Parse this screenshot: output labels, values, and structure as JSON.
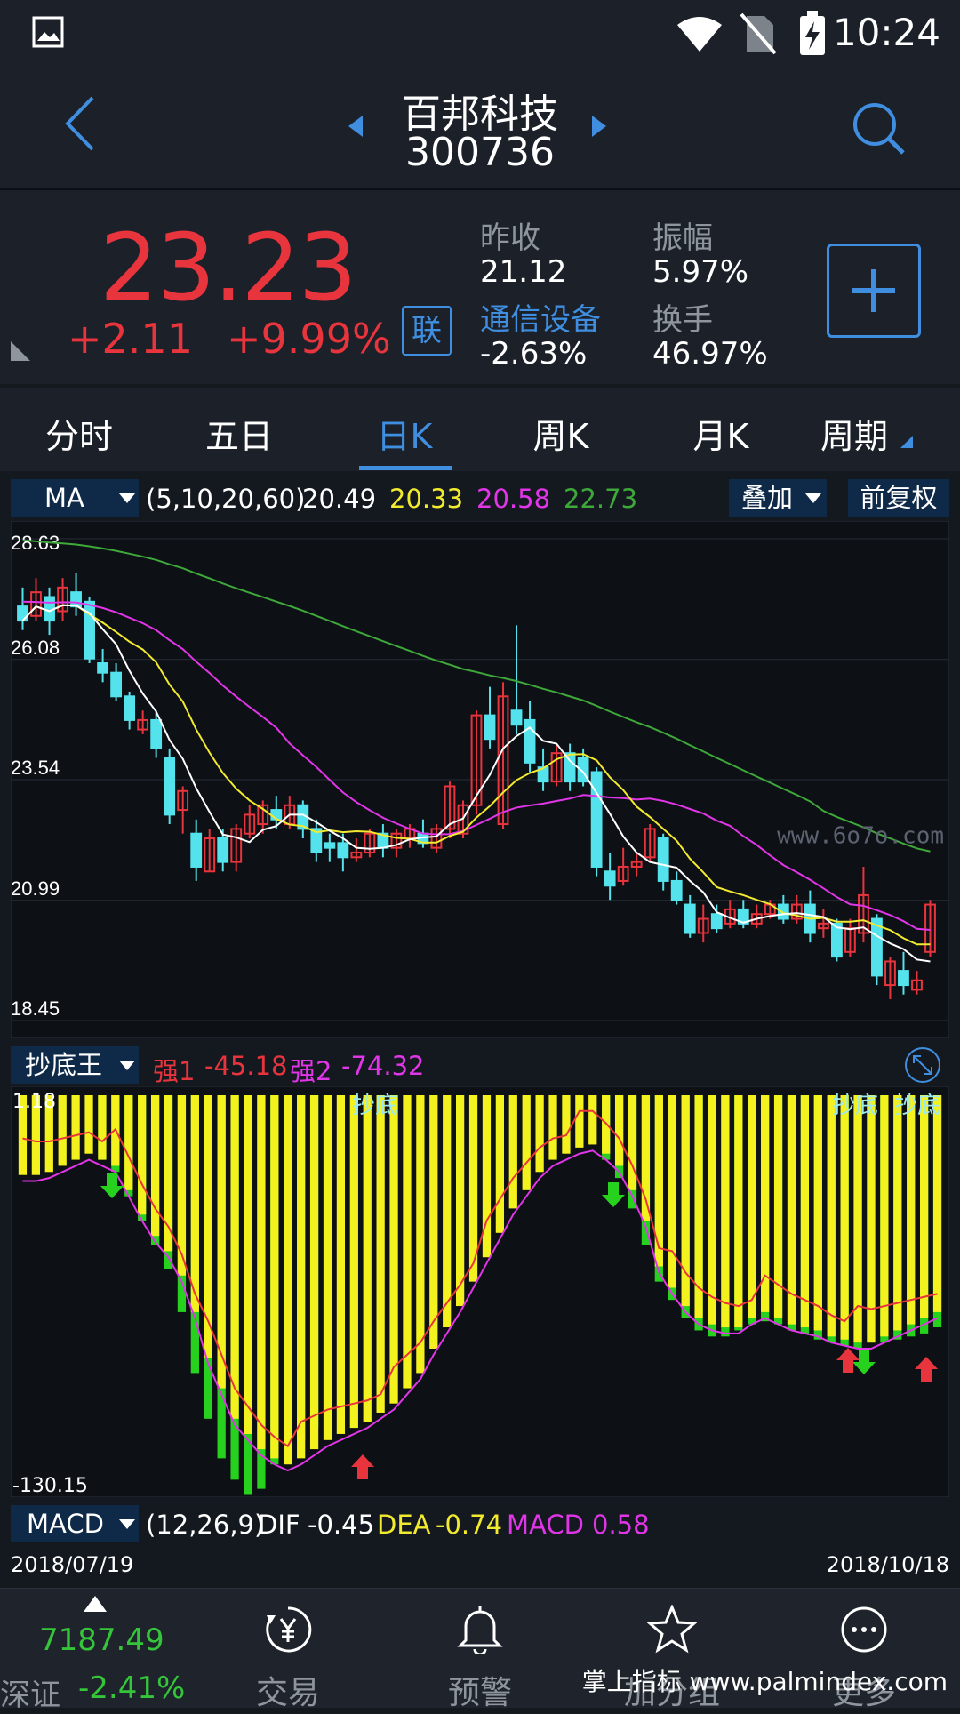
{
  "status_bar": {
    "time": "10:24"
  },
  "header": {
    "stock_name": "百邦科技",
    "stock_code": "300736"
  },
  "quote": {
    "price": "23.23",
    "change": "+2.11",
    "change_pct": "+9.99%",
    "link_badge": "联",
    "prev_close_label": "昨收",
    "prev_close": "21.12",
    "amplitude_label": "振幅",
    "amplitude": "5.97%",
    "sector_label": "通信设备",
    "sector_change": "-2.63%",
    "turnover_label": "换手",
    "turnover": "46.97%"
  },
  "tabs": [
    {
      "label": "分时"
    },
    {
      "label": "五日"
    },
    {
      "label": "日K"
    },
    {
      "label": "周K"
    },
    {
      "label": "月K"
    },
    {
      "label": "周期"
    }
  ],
  "active_tab": "日K",
  "ma_row": {
    "selector": "MA",
    "params": "(5,10,20,60)",
    "ma5": "20.49",
    "ma10": "20.33",
    "ma20": "20.58",
    "ma60": "22.73",
    "overlay_label": "叠加",
    "adjust_label": "前复权"
  },
  "main_chart": {
    "y_labels": [
      "28.63",
      "26.08",
      "23.54",
      "20.99",
      "18.45"
    ],
    "watermark": "www.6o7o.com"
  },
  "sub_row": {
    "selector": "抄底王",
    "strong1_label": "强1",
    "strong1": "-45.18",
    "strong2_label": "强2",
    "strong2": "-74.32"
  },
  "sub_chart": {
    "y_top": "1.18",
    "y_bottom": "-130.15",
    "signal_labels": [
      "抄底",
      "抄底",
      "抄底"
    ]
  },
  "macd_row": {
    "selector": "MACD",
    "params": "(12,26,9)",
    "dif_label": "DIF",
    "dif": "-0.45",
    "dea_label": "DEA",
    "dea": "-0.74",
    "macd_label": "MACD",
    "macd": "0.58"
  },
  "date_range": {
    "start": "2018/07/19",
    "end": "2018/10/18"
  },
  "bottom_nav": {
    "index_value": "7187.49",
    "index_name": "深证",
    "index_change": "-2.41%",
    "items": [
      {
        "label": "交易",
        "icon": "yuan-icon"
      },
      {
        "label": "预警",
        "icon": "bell-icon"
      },
      {
        "label": "加分组",
        "icon": "star-icon"
      },
      {
        "label": "更多",
        "icon": "more-icon"
      }
    ]
  },
  "watermark_bottom": "掌上指标 www.palmindex.com",
  "colors": {
    "up": "#e8343c",
    "down": "#54e3ec",
    "accent": "#3f8ee0",
    "ma5": "#ffffff",
    "ma10": "#f2ea2e",
    "ma20": "#e135e8",
    "ma60": "#3ea83a"
  },
  "chart_data": [
    {
      "type": "candlestick",
      "x_start": "2018/07/19",
      "x_end": "2018/10/18",
      "ylim": [
        18.45,
        28.63
      ],
      "y_ticks": [
        28.63,
        26.08,
        23.54,
        20.99,
        18.45
      ],
      "candles": [
        [
          27.2,
          26.9,
          27.6,
          26.7
        ],
        [
          27.0,
          27.5,
          27.8,
          26.9
        ],
        [
          27.4,
          26.9,
          27.6,
          26.6
        ],
        [
          27.1,
          27.6,
          27.8,
          26.9
        ],
        [
          27.5,
          27.2,
          27.9,
          27.0
        ],
        [
          27.3,
          26.1,
          27.4,
          26.0
        ],
        [
          26.0,
          25.8,
          26.3,
          25.6
        ],
        [
          25.8,
          25.3,
          26.0,
          25.2
        ],
        [
          25.3,
          24.8,
          25.4,
          24.6
        ],
        [
          24.6,
          24.8,
          25.0,
          24.5
        ],
        [
          24.8,
          24.2,
          25.0,
          24.0
        ],
        [
          24.0,
          22.8,
          24.2,
          22.6
        ],
        [
          22.9,
          23.3,
          23.4,
          22.4
        ],
        [
          22.4,
          21.7,
          22.7,
          21.4
        ],
        [
          21.6,
          22.3,
          22.5,
          21.6
        ],
        [
          22.3,
          21.8,
          22.5,
          21.6
        ],
        [
          21.8,
          22.5,
          22.6,
          21.6
        ],
        [
          22.4,
          22.8,
          23.0,
          22.3
        ],
        [
          22.6,
          23.0,
          23.1,
          22.4
        ],
        [
          22.9,
          22.7,
          23.2,
          22.5
        ],
        [
          22.6,
          23.0,
          23.2,
          22.5
        ],
        [
          23.0,
          22.5,
          23.1,
          22.3
        ],
        [
          22.5,
          22.0,
          22.7,
          21.8
        ],
        [
          22.2,
          22.1,
          22.4,
          21.8
        ],
        [
          22.2,
          21.9,
          22.4,
          21.6
        ],
        [
          21.9,
          22.0,
          22.3,
          21.8
        ],
        [
          22.0,
          22.4,
          22.5,
          21.9
        ],
        [
          22.4,
          22.1,
          22.6,
          21.9
        ],
        [
          22.1,
          22.4,
          22.5,
          21.9
        ],
        [
          22.3,
          22.5,
          22.6,
          22.1
        ],
        [
          22.4,
          22.2,
          22.7,
          22.1
        ],
        [
          22.1,
          22.5,
          22.6,
          22.0
        ],
        [
          22.5,
          23.4,
          23.5,
          22.3
        ],
        [
          22.4,
          23.0,
          23.1,
          22.3
        ],
        [
          23.0,
          24.9,
          25.0,
          22.8
        ],
        [
          24.9,
          24.4,
          25.5,
          24.2
        ],
        [
          22.6,
          25.3,
          25.6,
          22.5
        ],
        [
          25.0,
          24.7,
          26.8,
          24.5
        ],
        [
          24.8,
          23.9,
          25.2,
          23.7
        ],
        [
          23.8,
          23.5,
          24.2,
          23.3
        ],
        [
          23.5,
          24.1,
          24.3,
          23.4
        ],
        [
          24.1,
          23.5,
          24.3,
          23.3
        ],
        [
          24.0,
          23.5,
          24.2,
          23.4
        ],
        [
          23.7,
          21.7,
          23.8,
          21.5
        ],
        [
          21.6,
          21.3,
          22.0,
          21.0
        ],
        [
          21.4,
          21.7,
          22.1,
          21.3
        ],
        [
          21.7,
          21.8,
          22.0,
          21.5
        ],
        [
          21.9,
          22.5,
          22.6,
          21.8
        ],
        [
          22.3,
          21.4,
          22.4,
          21.2
        ],
        [
          21.4,
          21.0,
          21.6,
          20.9
        ],
        [
          20.9,
          20.3,
          21.1,
          20.2
        ],
        [
          20.3,
          20.6,
          20.9,
          20.1
        ],
        [
          20.7,
          20.4,
          20.9,
          20.3
        ],
        [
          20.5,
          20.8,
          21.0,
          20.4
        ],
        [
          20.8,
          20.5,
          21.0,
          20.4
        ],
        [
          20.5,
          20.7,
          20.9,
          20.4
        ],
        [
          20.7,
          20.9,
          21.0,
          20.6
        ],
        [
          20.9,
          20.6,
          21.1,
          20.5
        ],
        [
          20.6,
          20.9,
          21.1,
          20.5
        ],
        [
          20.9,
          20.3,
          21.2,
          20.1
        ],
        [
          20.4,
          20.5,
          20.8,
          20.2
        ],
        [
          20.5,
          19.8,
          20.6,
          19.7
        ],
        [
          19.9,
          20.4,
          20.6,
          19.8
        ],
        [
          20.3,
          21.1,
          21.7,
          20.1
        ],
        [
          20.6,
          19.4,
          20.7,
          19.2
        ],
        [
          19.2,
          19.7,
          19.8,
          18.9
        ],
        [
          19.5,
          19.2,
          19.9,
          19.0
        ],
        [
          19.1,
          19.3,
          19.5,
          19.0
        ],
        [
          19.9,
          20.9,
          21.0,
          19.8
        ]
      ],
      "ma": {
        "ma5": 20.49,
        "ma10": 20.33,
        "ma20": 20.58,
        "ma60": 22.73
      }
    },
    {
      "type": "bar",
      "name": "抄底王",
      "ylim": [
        -130.15,
        1.18
      ],
      "values": [
        -25,
        -25,
        -24,
        -22,
        -20,
        -18,
        -20,
        -22,
        -30,
        -38,
        -45,
        -50,
        -58,
        -70,
        -85,
        -95,
        -105,
        -110,
        -115,
        -118,
        -120,
        -118,
        -115,
        -112,
        -110,
        -108,
        -106,
        -103,
        -100,
        -95,
        -90,
        -82,
        -75,
        -68,
        -60,
        -52,
        -44,
        -36,
        -30,
        -24,
        -20,
        -18,
        -16,
        -15,
        -18,
        -22,
        -30,
        -40,
        -55,
        -62,
        -68,
        -72,
        -74,
        -75,
        -75,
        -72,
        -70,
        -72,
        -74,
        -75,
        -76,
        -78,
        -79,
        -80,
        -80,
        -78,
        -76,
        -74,
        -72,
        -70
      ],
      "green_values": [
        0,
        0,
        0,
        0,
        0,
        0,
        -20,
        -24,
        -32,
        -40,
        -48,
        -56,
        -70,
        -90,
        -105,
        -118,
        -125,
        -130,
        -128,
        -120,
        -115,
        -112,
        -108,
        0,
        0,
        0,
        0,
        0,
        0,
        0,
        0,
        0,
        0,
        0,
        0,
        0,
        0,
        0,
        0,
        0,
        0,
        0,
        0,
        0,
        -20,
        -26,
        -36,
        -48,
        -60,
        -66,
        -72,
        -76,
        -78,
        -78,
        -76,
        -74,
        -73,
        -74,
        -76,
        -77,
        -79,
        -80,
        -81,
        -82,
        -80,
        -80,
        -79,
        -78,
        -77,
        -75
      ]
    }
  ]
}
